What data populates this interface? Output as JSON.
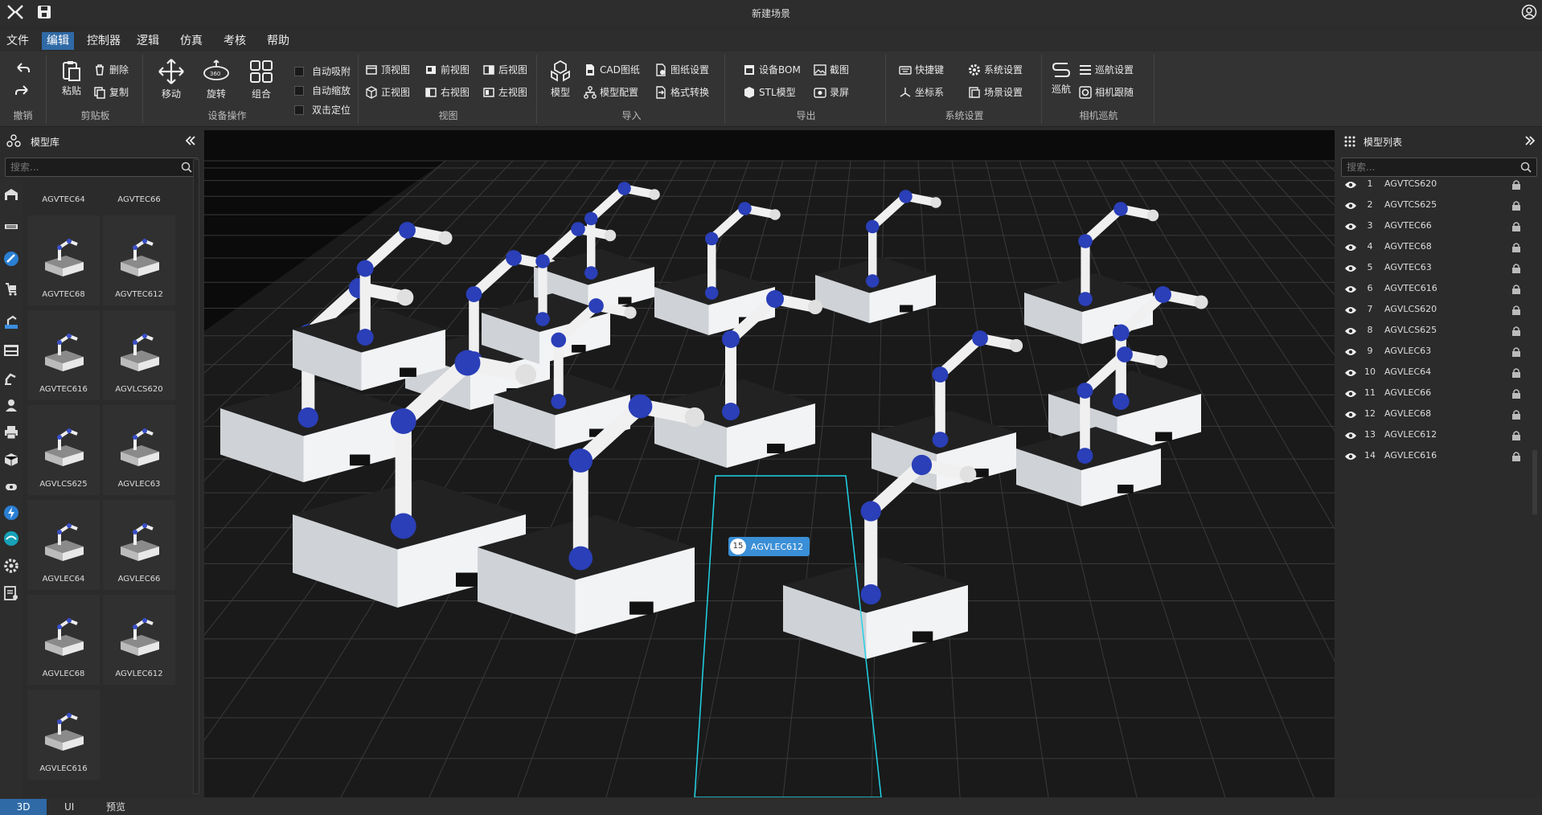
{
  "app": {
    "title": "新建场景"
  },
  "menu": [
    "文件",
    "编辑",
    "控制器",
    "逻辑",
    "仿真",
    "考核",
    "帮助"
  ],
  "ribbon": {
    "undo": {
      "label": "撤销"
    },
    "clipboard": {
      "label": "剪贴板",
      "paste": "粘贴",
      "delete": "删除",
      "copy": "复制"
    },
    "device_ops": {
      "label": "设备操作",
      "move": "移动",
      "rotate": "旋转",
      "group": "组合",
      "auto_snap": "自动吸附",
      "auto_zoom": "自动缩放",
      "dblclick_locate": "双击定位",
      "rotate_badge": "360"
    },
    "view": {
      "label": "视图",
      "top": "顶视图",
      "front": "前视图",
      "back": "后视图",
      "ortho": "正视图",
      "right": "右视图",
      "left": "左视图"
    },
    "import": {
      "label": "导入",
      "model": "模型",
      "cad": "CAD图纸",
      "model_config": "模型配置",
      "drawing_settings": "图纸设置",
      "format_convert": "格式转换"
    },
    "export": {
      "label": "导出",
      "bom": "设备BOM",
      "stl": "STL模型",
      "screenshot": "截图",
      "record": "录屏"
    },
    "system": {
      "label": "系统设置",
      "shortcut": "快捷键",
      "coord": "坐标系",
      "sys_settings": "系统设置",
      "scene_settings": "场景设置"
    },
    "camera": {
      "label": "相机巡航",
      "cruise": "巡航",
      "cruise_settings": "巡航设置",
      "camera_follow": "相机跟随"
    }
  },
  "model_library": {
    "title": "模型库",
    "search_placeholder": "搜索...",
    "items": [
      "AGVTEC64",
      "AGVTEC66",
      "AGVTEC68",
      "AGVTEC612",
      "AGVTEC616",
      "AGVLCS620",
      "AGVLCS625",
      "AGVLEC63",
      "AGVLEC64",
      "AGVLEC66",
      "AGVLEC68",
      "AGVLEC612",
      "AGVLEC616"
    ]
  },
  "model_list": {
    "title": "模型列表",
    "search_placeholder": "搜索...",
    "items": [
      {
        "idx": "1",
        "name": "AGVTCS620"
      },
      {
        "idx": "2",
        "name": "AGVTCS625"
      },
      {
        "idx": "3",
        "name": "AGVTEC66"
      },
      {
        "idx": "4",
        "name": "AGVTEC68"
      },
      {
        "idx": "5",
        "name": "AGVTEC63"
      },
      {
        "idx": "6",
        "name": "AGVTEC616"
      },
      {
        "idx": "7",
        "name": "AGVLCS620"
      },
      {
        "idx": "8",
        "name": "AGVLCS625"
      },
      {
        "idx": "9",
        "name": "AGVLEC63"
      },
      {
        "idx": "10",
        "name": "AGVLEC64"
      },
      {
        "idx": "11",
        "name": "AGVLEC66"
      },
      {
        "idx": "12",
        "name": "AGVLEC68"
      },
      {
        "idx": "13",
        "name": "AGVLEC612"
      },
      {
        "idx": "14",
        "name": "AGVLEC616"
      }
    ]
  },
  "viewport": {
    "selected_badge": "15",
    "selected_label": "AGVLEC612"
  },
  "bottom_tabs": [
    "3D",
    "UI",
    "预览"
  ],
  "colors": {
    "accent": "#2f6aa6",
    "robot_blue": "#2a3fb8",
    "selection": "#22d3e6"
  }
}
